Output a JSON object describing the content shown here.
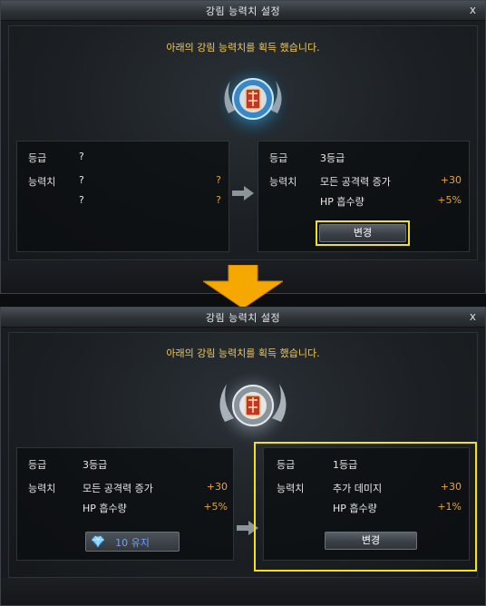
{
  "top": {
    "title": "강림 능력치 설정",
    "close": "x",
    "headline": "아래의 강림 능력치를 획득 했습니다.",
    "left": {
      "grade_label": "등급",
      "grade_value": "?",
      "stat_label": "능력치",
      "stat1_name": "?",
      "stat1_value": "?",
      "stat2_name": "?",
      "stat2_value": "?"
    },
    "right": {
      "grade_label": "등급",
      "grade_value": "3등급",
      "stat_label": "능력치",
      "stat1_name": "모든 공격력 증가",
      "stat1_value": "+30",
      "stat2_name": "HP 흡수량",
      "stat2_value": "+5%"
    },
    "change_button": "변경"
  },
  "bottom": {
    "title": "강림 능력치 설정",
    "close": "x",
    "headline": "아래의 강림 능력치를 획득 했습니다.",
    "left": {
      "grade_label": "등급",
      "grade_value": "3등급",
      "stat_label": "능력치",
      "stat1_name": "모든 공격력 증가",
      "stat1_value": "+30",
      "stat2_name": "HP 흡수량",
      "stat2_value": "+5%",
      "gem_cost": "10 유지"
    },
    "right": {
      "grade_label": "등급",
      "grade_value": "1등급",
      "stat_label": "능력치",
      "stat1_name": "추가 데미지",
      "stat1_value": "+30",
      "stat2_name": "HP 흡수량",
      "stat2_value": "+1%"
    },
    "change_button": "변경"
  },
  "colors": {
    "accent_gold": "#f0c85a",
    "value_orange": "#e7a431",
    "highlight_yellow": "#f2e21d",
    "transition_arrow": "#f5a800"
  },
  "icons": [
    "close-icon",
    "emblem-icon",
    "arrow-right-icon",
    "down-arrow-icon",
    "gem-icon"
  ]
}
